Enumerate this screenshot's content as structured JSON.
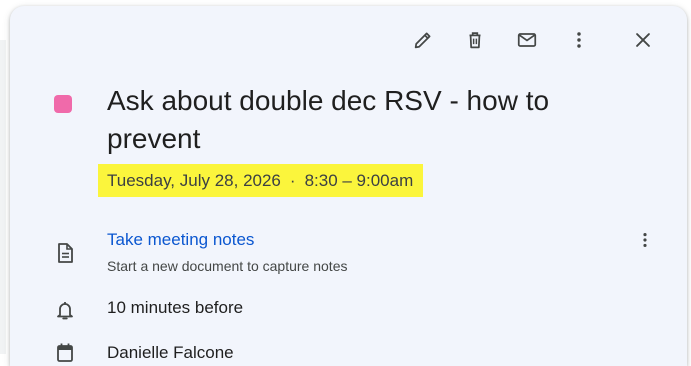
{
  "toolbar": {
    "icons": [
      "pencil-icon",
      "trash-icon",
      "mail-icon",
      "more-vert-icon",
      "close-icon"
    ]
  },
  "event": {
    "color": "#f06aaa",
    "title": "Ask about double dec RSV - how to prevent",
    "date": "Tuesday, July 28, 2026",
    "separator": "·",
    "time": "8:30 – 9:00am",
    "highlight_color": "#fbf53c"
  },
  "notes": {
    "icon": "document-icon",
    "link": "Take meeting notes",
    "subtitle": "Start a new document to capture notes"
  },
  "reminder": {
    "icon": "bell-icon",
    "text": "10 minutes before"
  },
  "calendar": {
    "icon": "calendar-icon",
    "owner": "Danielle Falcone"
  },
  "colors": {
    "card_background": "#f2f5fc",
    "link": "#0b57d0",
    "text_primary": "#1f1f1f"
  }
}
